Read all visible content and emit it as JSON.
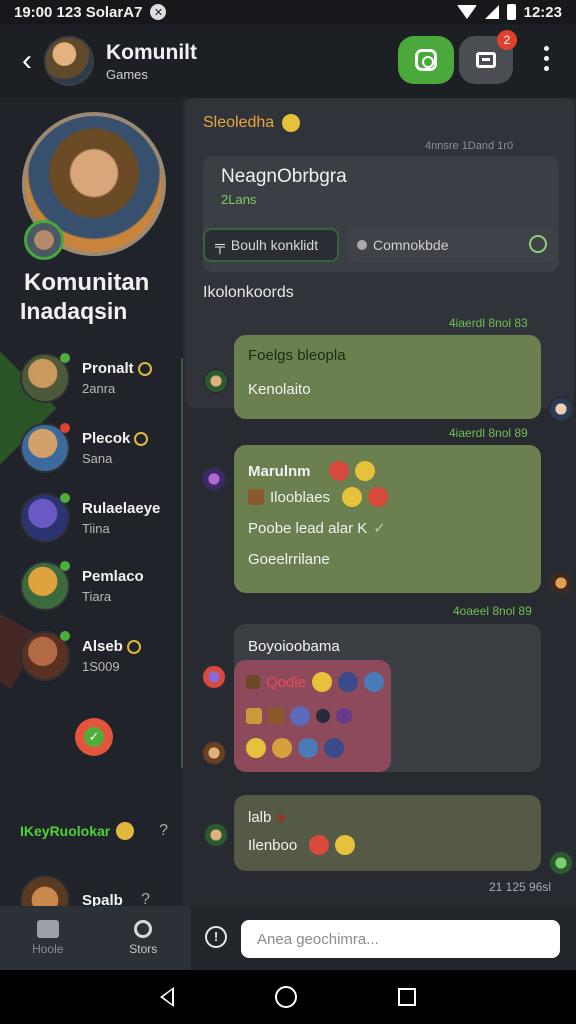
{
  "status_bar": {
    "time_left": "19:00 123 SolarA7",
    "time_right": "12:23"
  },
  "header": {
    "title": "Komunilt",
    "subtitle": "Games",
    "badge_count": "2"
  },
  "group": {
    "title": "Komunitan",
    "subtitle": "Inadaqsin"
  },
  "members": [
    {
      "name": "Pronalt",
      "sub": "2anra",
      "dot_color": "#4fae3a",
      "avatar_colors": [
        "#c99a5c",
        "#4d5a3a"
      ]
    },
    {
      "name": "Plecok",
      "sub": "Sana",
      "dot_color": "#e0412f",
      "avatar_colors": [
        "#d2a06a",
        "#3c6a9c"
      ]
    },
    {
      "name": "Rulaelaeye",
      "sub": "Tiina",
      "dot_color": "#4fae3a",
      "avatar_colors": [
        "#6a58c4",
        "#2b3470"
      ]
    },
    {
      "name": "Pemlaco",
      "sub": "Tiara",
      "dot_color": "#4fae3a",
      "avatar_colors": [
        "#e0a23c",
        "#3c6a3c"
      ]
    },
    {
      "name": "Alseb",
      "sub": "1S009",
      "dot_color": "#4fae3a",
      "avatar_colors": [
        "#b36a44",
        "#5a3020"
      ]
    }
  ],
  "invite": {
    "label": "IKeyRuolokar",
    "help": "?"
  },
  "member_last": {
    "name": "Spalb",
    "help": "?"
  },
  "left_nav": {
    "tab1": "Hoole",
    "tab2": "Stors"
  },
  "chat": {
    "pinned_label": "Sleoledha",
    "pinned_meta": "4nnsre 1Dand 1r0",
    "info_title": "NeagnObrbgra",
    "info_sub": "2Lans",
    "chip1_label": "Boulh konklidt",
    "chip2_label": "Comnokbde",
    "section_title": "Ikolonkoords",
    "messages": [
      {
        "meta": "4iaerdl 8nol 83",
        "line1": "Foelgs bleopla",
        "line2": "Kenolaito"
      },
      {
        "meta": "4iaerdl 8nol 89",
        "line1": "Marulnm",
        "line2": "Ilooblaes",
        "line3": "Poobe lead alar K",
        "line4": "Goeelrrilane"
      },
      {
        "meta": "4oaeel 8nol 89",
        "line1": "Boyoioobama",
        "line2": "Qodie"
      },
      {
        "line1": "lalb",
        "line2": "Ilenboo"
      }
    ],
    "last_meta": "21 125 96sl"
  },
  "composer": {
    "placeholder": "Anea geochimra..."
  }
}
